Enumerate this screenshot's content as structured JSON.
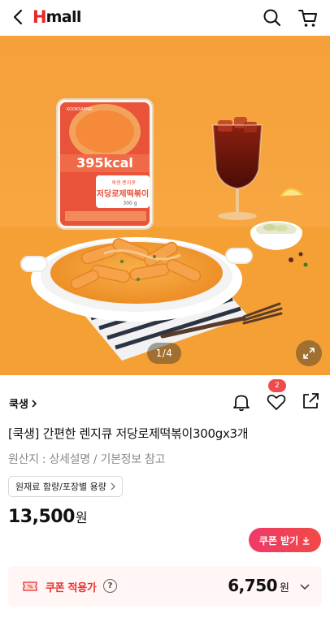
{
  "header": {
    "logo_h": "H",
    "logo_rest": "mall",
    "icons": [
      "back-icon",
      "search-icon",
      "cart-icon"
    ]
  },
  "gallery": {
    "counter": "1/4",
    "package_calories": "395kcal",
    "package_name": "저당로제떡볶이",
    "package_sub": "쿡생 렌지큐",
    "package_weight": "300 g",
    "brand_tag": "KOOKSAENG",
    "colors": {
      "background": "#f7a238",
      "package": "#e9533a",
      "sauce": "#f29a2e"
    }
  },
  "product": {
    "brand": "쿡생",
    "title": "[쿡생] 간편한 렌지큐 저당로제떡볶이300gx3개",
    "origin": "원산지 : 상세설명 / 기본정보 참고",
    "capacity_button": "원재료 함량/포장별 용량",
    "price": "13,500",
    "currency": "원",
    "like_count": "2",
    "coupon_button": "쿠폰 받기"
  },
  "coupon": {
    "label": "쿠폰 적용가",
    "help": "?",
    "price": "6,750",
    "currency": "원"
  },
  "accent": "#e8302d"
}
